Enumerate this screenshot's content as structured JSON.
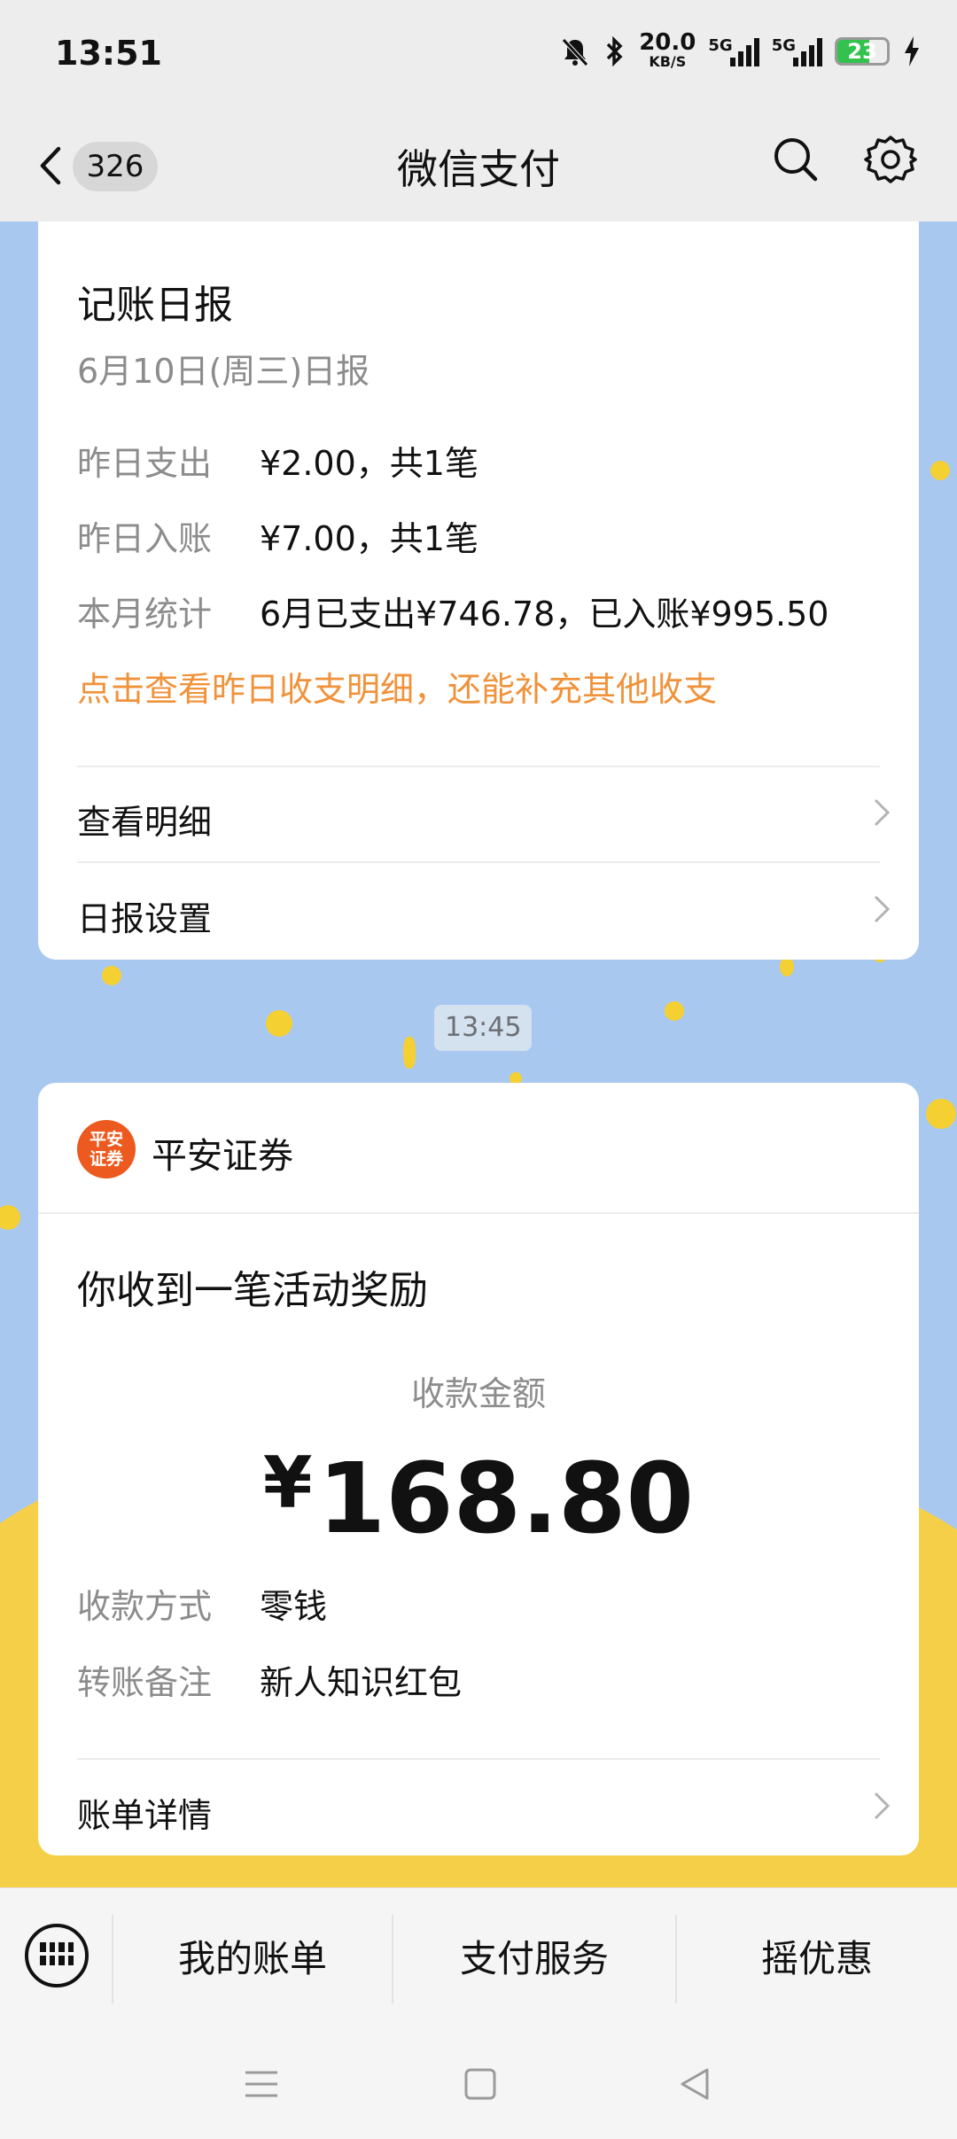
{
  "status_bar": {
    "time": "13:51",
    "net_speed_value": "20.0",
    "net_speed_unit": "KB/S",
    "signal_1_label": "5G",
    "signal_2_label": "5G",
    "battery_level": "23",
    "icons": [
      "mute-icon",
      "bluetooth-icon",
      "signal-icon",
      "battery-icon",
      "charging-icon"
    ]
  },
  "header": {
    "unread_count": "326",
    "title": "微信支付",
    "icons": [
      "back-icon",
      "search-icon",
      "settings-icon"
    ]
  },
  "report_card": {
    "title": "记账日报",
    "subtitle": "6月10日(周三)日报",
    "rows": [
      {
        "label": "昨日支出",
        "value": "¥2.00，共1笔"
      },
      {
        "label": "昨日入账",
        "value": "¥7.00，共1笔"
      },
      {
        "label": "本月统计",
        "value": "6月已支出¥746.78，已入账¥995.50"
      }
    ],
    "link_text": "点击查看昨日收支明细，还能补充其他收支",
    "menu": [
      {
        "label": "查看明细"
      },
      {
        "label": "日报设置"
      }
    ]
  },
  "timestamp": "13:45",
  "payment_card": {
    "brand_logo_text": "平安证券",
    "brand_name": "平安证券",
    "title": "你收到一笔活动奖励",
    "amount_label": "收款金额",
    "currency_symbol": "¥",
    "amount": "168.80",
    "rows": [
      {
        "label": "收款方式",
        "value": "零钱"
      },
      {
        "label": "转账备注",
        "value": "新人知识红包"
      }
    ],
    "menu": [
      {
        "label": "账单详情"
      }
    ]
  },
  "bottom_bar": {
    "tabs": [
      {
        "label": "我的账单"
      },
      {
        "label": "支付服务"
      },
      {
        "label": "摇优惠"
      }
    ]
  },
  "colors": {
    "accent_orange": "#f0923a",
    "brand_red": "#ec5a1f",
    "battery_green": "#33c24d",
    "chat_background": "#a9c8ef"
  }
}
